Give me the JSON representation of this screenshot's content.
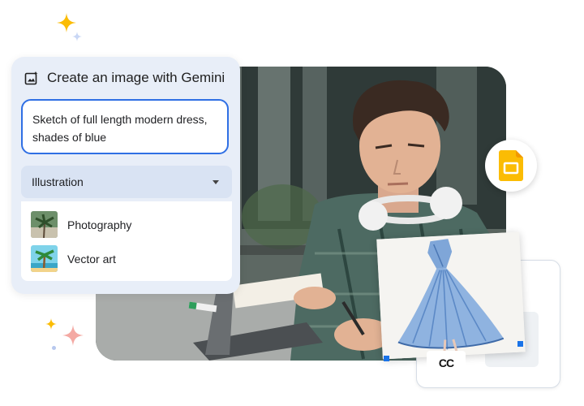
{
  "panel": {
    "title": "Create an image with Gemini",
    "prompt_text": "Sketch of full length modern dress, shades of blue",
    "style_select": {
      "selected": "Illustration"
    },
    "options": [
      {
        "label": "Photography"
      },
      {
        "label": "Vector art"
      }
    ]
  },
  "slide": {
    "brand_mark": "CC"
  },
  "icons": [
    "sparkle-icon",
    "image-sparkle-icon",
    "chevron-down-icon",
    "google-slides-icon"
  ],
  "colors": {
    "accent_blue": "#1a73e8",
    "panel_bg": "#e8eef8",
    "select_bg": "#d9e3f3",
    "sparkle_yellow": "#fbbc04",
    "sparkle_pink": "#f28b82",
    "slides_yellow": "#fbbc04"
  }
}
